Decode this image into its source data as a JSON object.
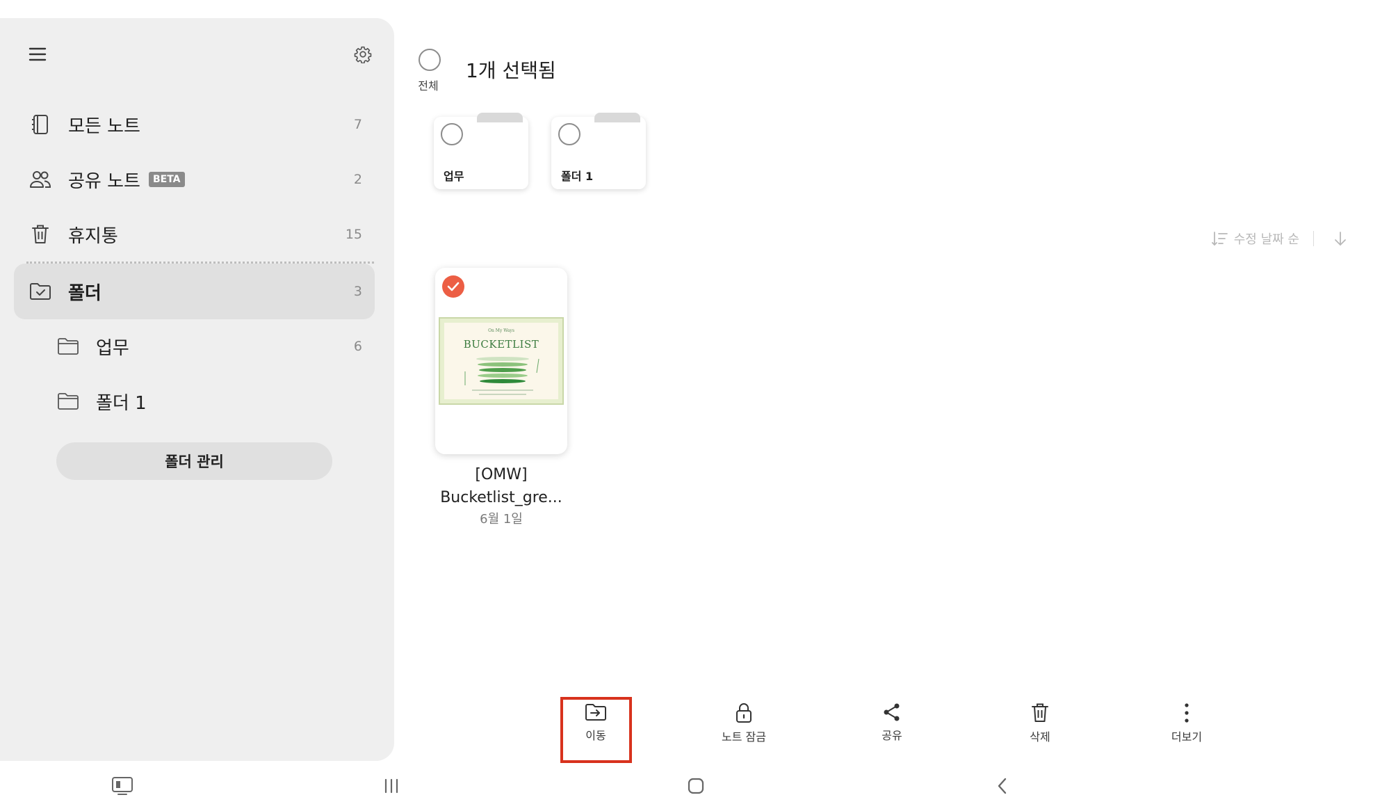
{
  "sidebar": {
    "items": [
      {
        "label": "모든 노트",
        "count": "7",
        "icon": "notebook-icon"
      },
      {
        "label": "공유 노트",
        "badge": "BETA",
        "count": "2",
        "icon": "people-icon"
      },
      {
        "label": "휴지통",
        "count": "15",
        "icon": "trash-icon"
      },
      {
        "label": "폴더",
        "count": "3",
        "icon": "folder-check-icon"
      },
      {
        "label": "업무",
        "count": "6",
        "icon": "folder-icon"
      },
      {
        "label": "폴더 1",
        "count": "",
        "icon": "folder-icon"
      }
    ],
    "manage_label": "폴더 관리"
  },
  "header": {
    "select_all_label": "전체",
    "title": "1개 선택됨"
  },
  "folders": [
    {
      "name": "업무"
    },
    {
      "name": "폴더 1"
    }
  ],
  "sort": {
    "label": "수정 날짜 순"
  },
  "note": {
    "thumb_small": "On My Ways",
    "thumb_title": "BUCKETLIST",
    "name_line1": "[OMW]",
    "name_line2": "Bucketlist_gre...",
    "date": "6월 1일"
  },
  "actions": [
    {
      "label": "이동",
      "icon": "move-folder-icon"
    },
    {
      "label": "노트 잠금",
      "icon": "lock-icon"
    },
    {
      "label": "공유",
      "icon": "share-icon"
    },
    {
      "label": "삭제",
      "icon": "trash-icon"
    },
    {
      "label": "더보기",
      "icon": "more-icon"
    }
  ],
  "colors": {
    "accent": "#ec5e44",
    "highlight": "#d8321d",
    "sidebar_bg": "#efefef"
  }
}
